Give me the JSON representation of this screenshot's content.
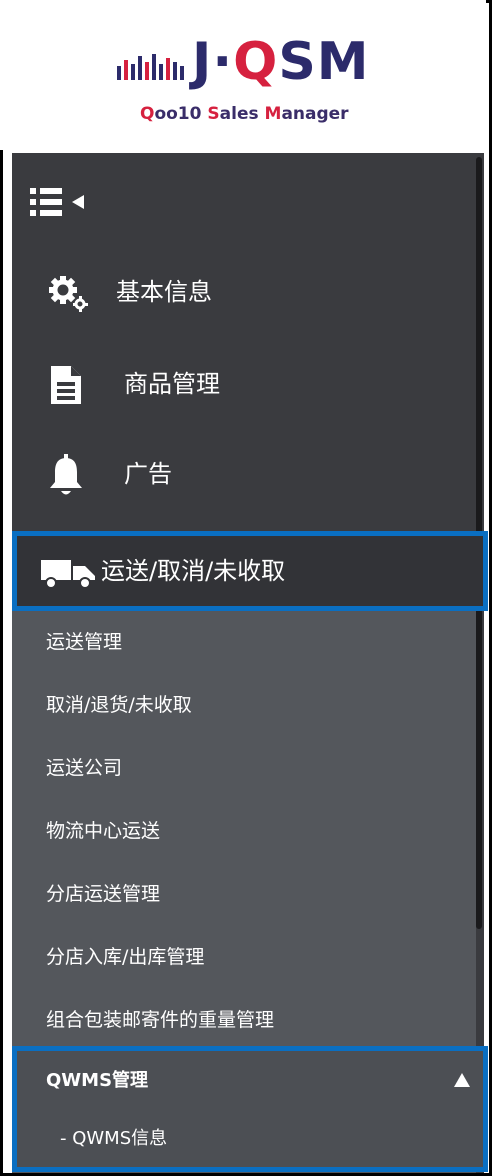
{
  "logo": {
    "mark_prefix": "J·",
    "mark_q": "Q",
    "mark_suffix": "SM",
    "tagline_q": "Q",
    "tagline_mid": "oo10 ",
    "tagline_s": "S",
    "tagline_ales": "ales ",
    "tagline_m": "M",
    "tagline_end": "anager"
  },
  "colors": {
    "sidebar_bg": "#3a3b3f",
    "submenu_bg": "#54575c",
    "highlight_border": "#0a6fc2",
    "brand_navy": "#2c2b6b",
    "brand_red": "#d6213f"
  },
  "sidebar": {
    "toggle": {
      "icon": "list-collapse-icon"
    },
    "items": [
      {
        "label": "基本信息",
        "icon": "gears-icon"
      },
      {
        "label": "商品管理",
        "icon": "document-icon"
      },
      {
        "label": "广告",
        "icon": "bell-icon"
      },
      {
        "label": "运送/取消/未收取",
        "icon": "truck-icon",
        "active": true
      }
    ],
    "shipping_submenu": [
      "运送管理",
      "取消/退货/未收取",
      "运送公司",
      "物流中心运送",
      "分店运送管理",
      "分店入库/出库管理",
      "组合包装邮寄件的重量管理"
    ],
    "qwms": {
      "title": "QWMS管理",
      "expand_icon": "triangle-up-icon",
      "children": [
        "- QWMS信息"
      ]
    }
  }
}
